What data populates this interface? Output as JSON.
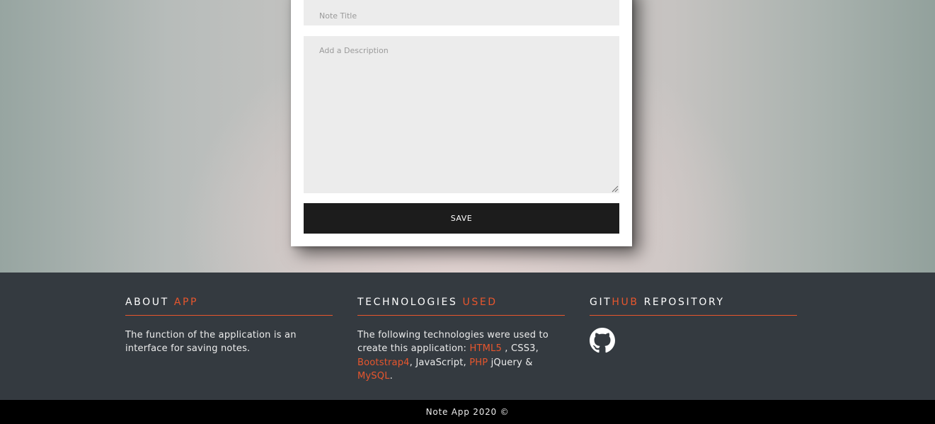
{
  "form": {
    "title_placeholder": "Note Title",
    "title_value": "",
    "description_placeholder": "Add a Description",
    "description_value": "",
    "save_label": "SAVE"
  },
  "footer": {
    "about": {
      "heading_main": "ABOUT",
      "heading_accent": "APP",
      "text": "The function of the application is an interface for saving notes."
    },
    "technologies": {
      "heading_main": "TECHNOLOGIES",
      "heading_accent": "USED",
      "intro": "The following technologies were used to create this application:",
      "items": {
        "html": "HTML5",
        "css": "CSS3",
        "bootstrap": "Bootstrap4",
        "js": "JavaScript",
        "php": "PHP",
        "jquery": "jQuery",
        "mysql": "MySQL"
      },
      "sep_comma": ",",
      "sep_amp": "&",
      "end": "."
    },
    "github": {
      "heading_part1": "GIT",
      "heading_accent": "HUB",
      "heading_part2": "REPOSITORY",
      "icon": "github-icon"
    }
  },
  "copyright": "Note App 2020 ©",
  "colors": {
    "accent": "#e8562d",
    "footer_bg": "#343a40",
    "bottom_bg": "#000000",
    "button_bg": "#1c1c1c",
    "input_bg": "#ececec"
  }
}
